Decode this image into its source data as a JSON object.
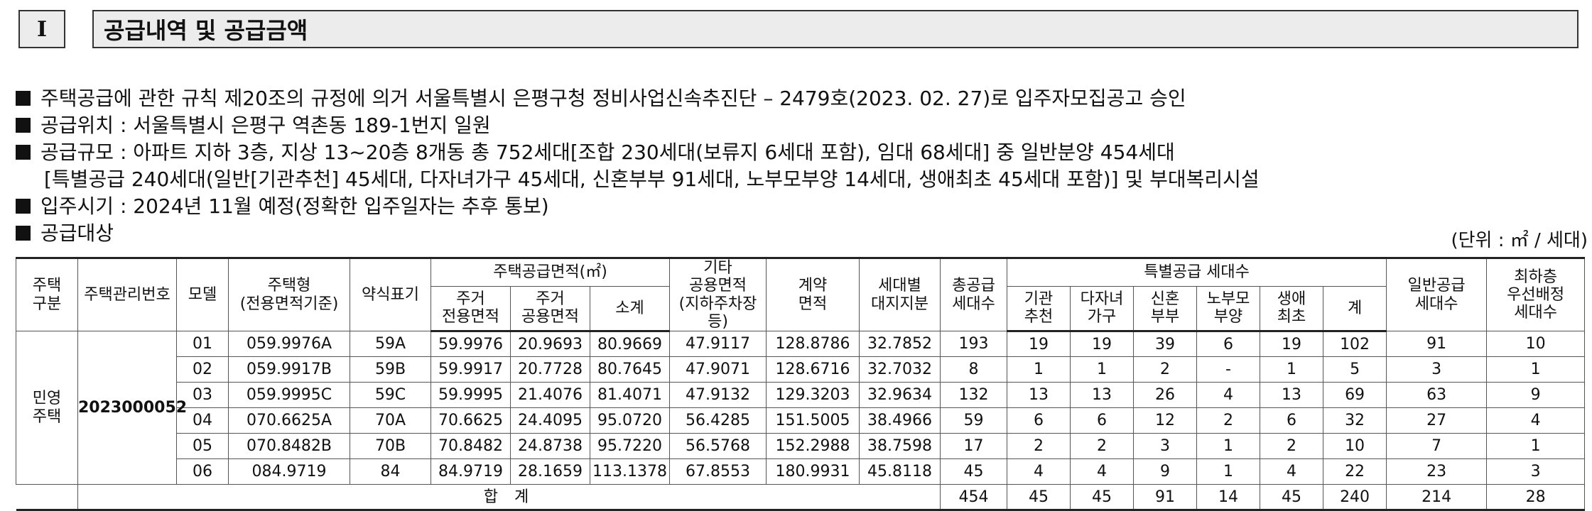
{
  "section": {
    "number": "I",
    "title": "공급내역 및 공급금액"
  },
  "bullets": [
    "주택공급에 관한 규칙 제20조의 규정에 의거 서울특별시 은평구청 정비사업신속추진단 – 2479호(2023. 02. 27)로 입주자모집공고 승인",
    "공급위치 : 서울특별시 은평구 역촌동 189-1번지 일원",
    "공급규모 : 아파트 지하 3층, 지상 13~20층 8개동 총 752세대[조합 230세대(보류지 6세대 포함), 임대 68세대] 중 일반분양 454세대",
    "[특별공급 240세대(일반[기관추천] 45세대, 다자녀가구 45세대, 신혼부부 91세대, 노부모부양 14세대, 생애최초 45세대 포함)] 및 부대복리시설",
    "입주시기 : 2024년 11월 예정(정확한 입주일자는 추후 통보)",
    "공급대상"
  ],
  "unit_note": "(단위 : ㎡ / 세대)",
  "table": {
    "headers": {
      "type": [
        "주택",
        "구분"
      ],
      "mgmt_no": "주택관리번호",
      "model": "모델",
      "housing_type": [
        "주택형",
        "(전용면적기준)"
      ],
      "abbr": "약식표기",
      "area_group": "주택공급면적(㎡)",
      "exclusive": [
        "주거",
        "전용면적"
      ],
      "common": [
        "주거",
        "공용면적"
      ],
      "subtotal": "소계",
      "other": [
        "기타",
        "공용면적",
        "(지하주차장등)"
      ],
      "contract": [
        "계약",
        "면적"
      ],
      "land_share": [
        "세대별",
        "대지지분"
      ],
      "total_units": [
        "총공급",
        "세대수"
      ],
      "special_group": "특별공급 세대수",
      "institution": [
        "기관",
        "추천"
      ],
      "multichild": [
        "다자녀",
        "가구"
      ],
      "newlywed": [
        "신혼",
        "부부"
      ],
      "elderly": [
        "노부모",
        "부양"
      ],
      "first_time": [
        "생애",
        "최초"
      ],
      "special_sum": "계",
      "general": [
        "일반공급",
        "세대수"
      ],
      "lowest_floor": [
        "최하층",
        "우선배정",
        "세대수"
      ]
    },
    "house_category": [
      "민영",
      "주택"
    ],
    "mgmt_no": "2023000052",
    "rows": [
      [
        "01",
        "059.9976A",
        "59A",
        "59.9976",
        "20.9693",
        "80.9669",
        "47.9117",
        "128.8786",
        "32.7852",
        "193",
        "19",
        "19",
        "39",
        "6",
        "19",
        "102",
        "91",
        "10"
      ],
      [
        "02",
        "059.9917B",
        "59B",
        "59.9917",
        "20.7728",
        "80.7645",
        "47.9071",
        "128.6716",
        "32.7032",
        "8",
        "1",
        "1",
        "2",
        "-",
        "1",
        "5",
        "3",
        "1"
      ],
      [
        "03",
        "059.9995C",
        "59C",
        "59.9995",
        "21.4076",
        "81.4071",
        "47.9132",
        "129.3203",
        "32.9634",
        "132",
        "13",
        "13",
        "26",
        "4",
        "13",
        "69",
        "63",
        "9"
      ],
      [
        "04",
        "070.6625A",
        "70A",
        "70.6625",
        "24.4095",
        "95.0720",
        "56.4285",
        "151.5005",
        "38.4966",
        "59",
        "6",
        "6",
        "12",
        "2",
        "6",
        "32",
        "27",
        "4"
      ],
      [
        "05",
        "070.8482B",
        "70B",
        "70.8482",
        "24.8738",
        "95.7220",
        "56.5768",
        "152.2988",
        "38.7598",
        "17",
        "2",
        "2",
        "3",
        "1",
        "2",
        "10",
        "7",
        "1"
      ],
      [
        "06",
        "084.9719",
        "84",
        "84.9719",
        "28.1659",
        "113.1378",
        "67.8553",
        "180.9931",
        "45.8118",
        "45",
        "4",
        "4",
        "9",
        "1",
        "4",
        "22",
        "23",
        "3"
      ]
    ],
    "total": {
      "label": "합 계",
      "values": [
        "454",
        "45",
        "45",
        "91",
        "14",
        "45",
        "240",
        "214",
        "28"
      ]
    }
  }
}
